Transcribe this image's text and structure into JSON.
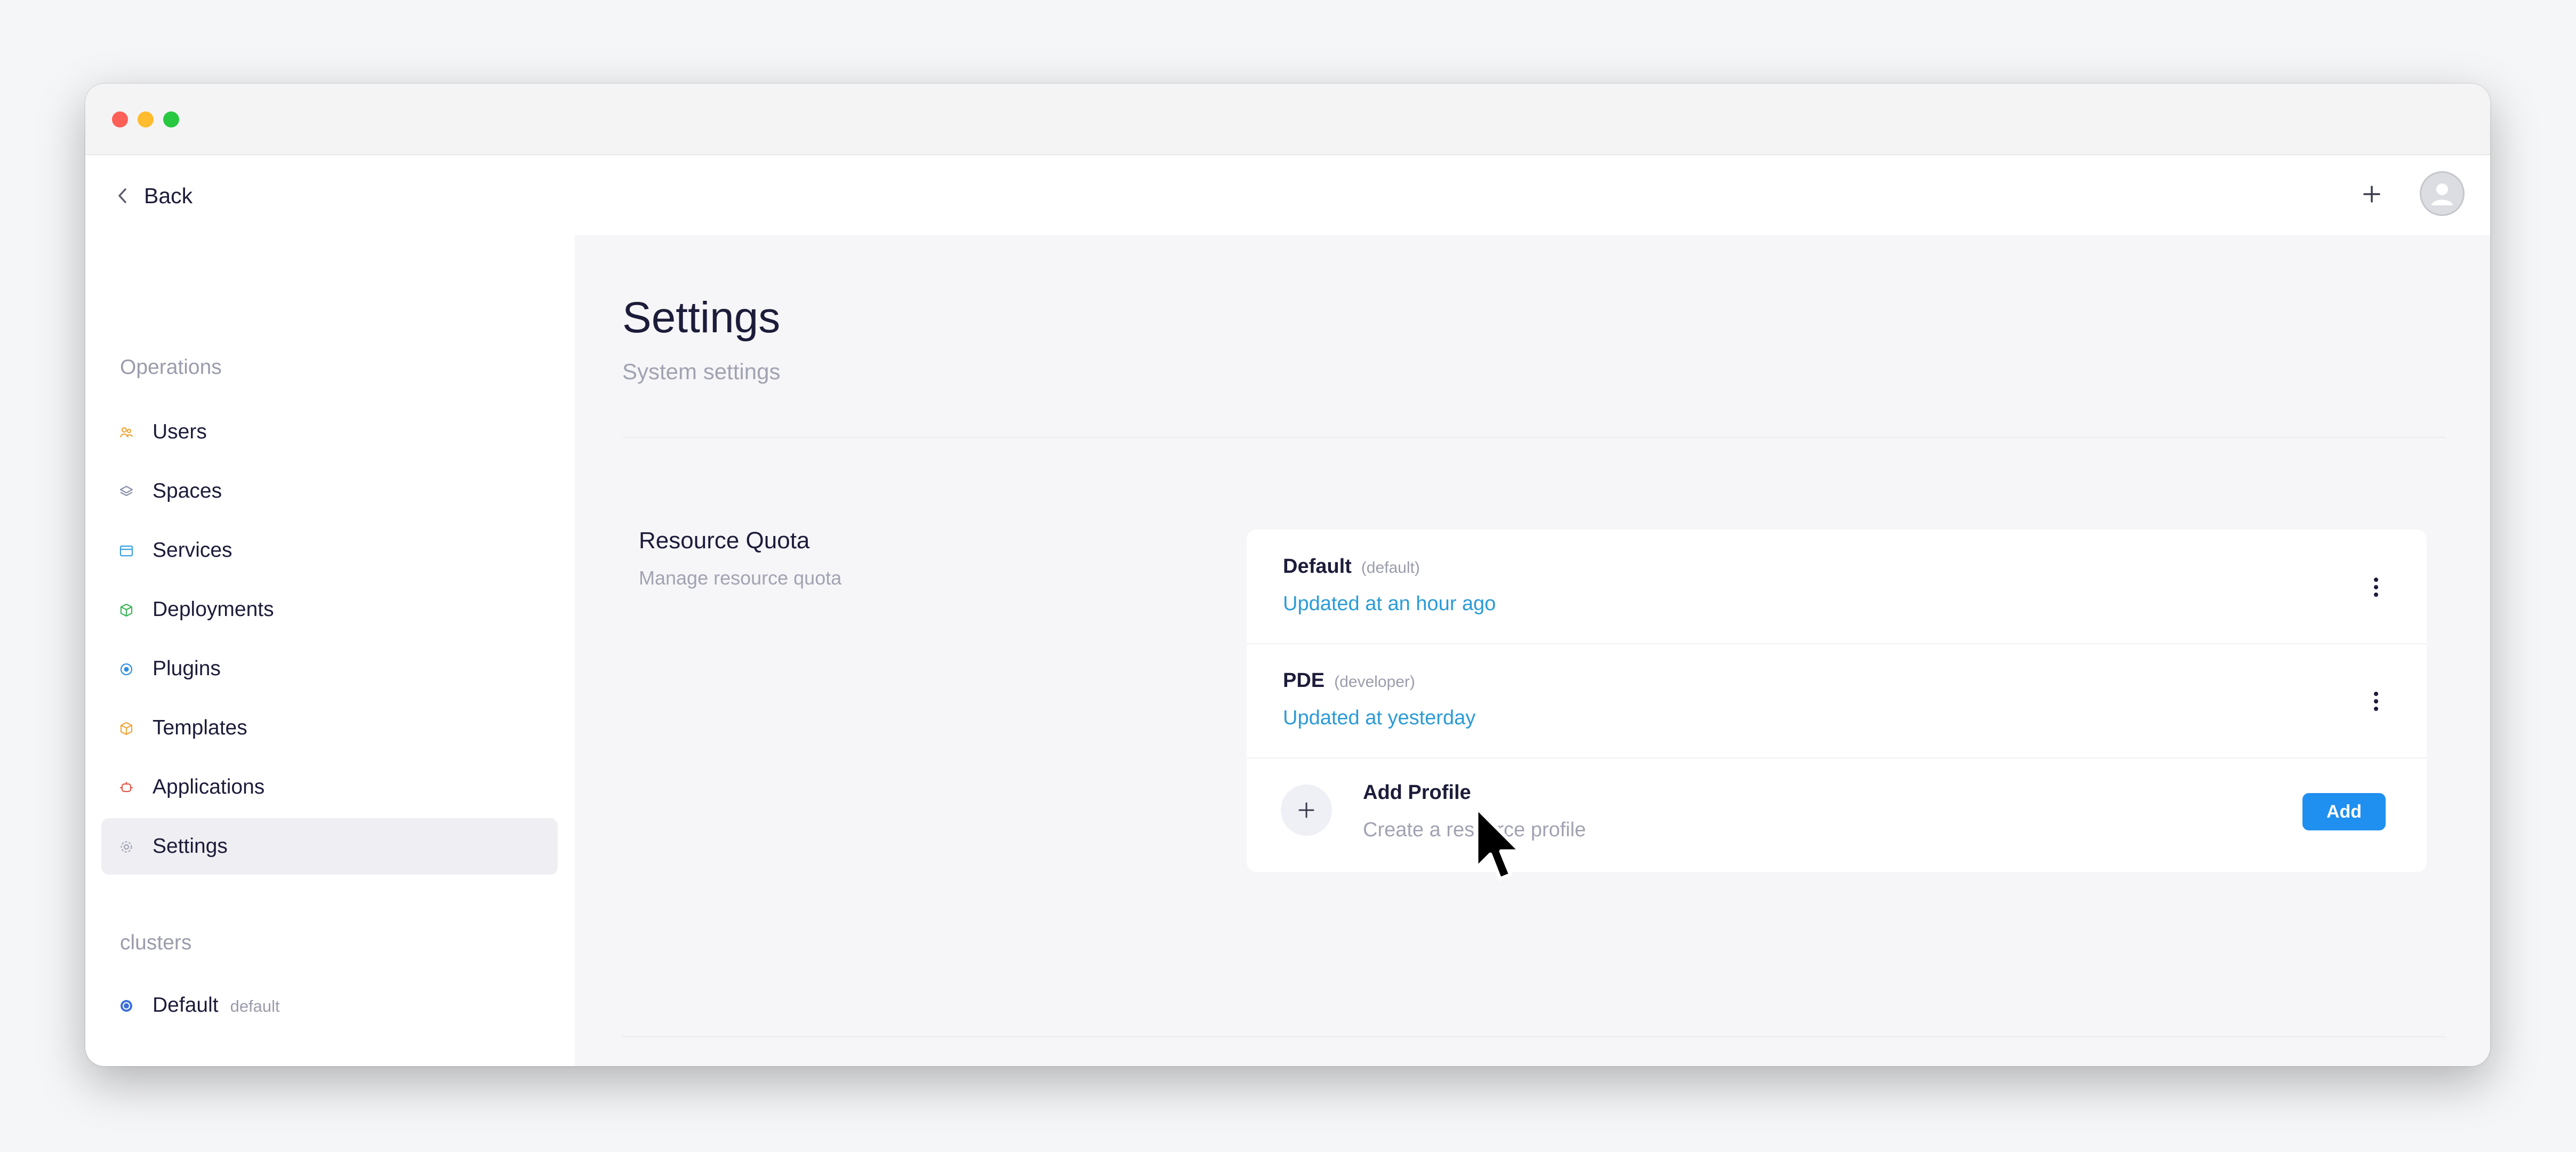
{
  "header": {
    "back_label": "Back"
  },
  "sidebar": {
    "section_operations": "Operations",
    "items": [
      {
        "label": "Users",
        "icon": "users-icon",
        "color": "#f0a63a"
      },
      {
        "label": "Spaces",
        "icon": "layers-icon",
        "color": "#8a8fa8"
      },
      {
        "label": "Services",
        "icon": "browser-window-icon",
        "color": "#3aa0e0"
      },
      {
        "label": "Deployments",
        "icon": "cube-icon",
        "color": "#3cb55a"
      },
      {
        "label": "Plugins",
        "icon": "plugin-icon",
        "color": "#2f8fe0"
      },
      {
        "label": "Templates",
        "icon": "box-icon",
        "color": "#f0a63a"
      },
      {
        "label": "Applications",
        "icon": "app-icon",
        "color": "#e05a4a"
      },
      {
        "label": "Settings",
        "icon": "gear-icon",
        "color": "#a0a3b4",
        "active": true
      }
    ],
    "section_clusters": "clusters",
    "clusters": [
      {
        "label": "Default",
        "tag": "default",
        "icon": "cluster-icon",
        "color": "#3b6fd8"
      }
    ]
  },
  "main": {
    "title": "Settings",
    "subtitle": "System settings",
    "section": {
      "title": "Resource Quota",
      "subtitle": "Manage resource quota"
    },
    "profiles": [
      {
        "name": "Default",
        "key": "(default)",
        "updated": "Updated at an hour ago"
      },
      {
        "name": "PDE",
        "key": "(developer)",
        "updated": "Updated at yesterday"
      }
    ],
    "add_profile": {
      "title": "Add Profile",
      "subtitle": "Create a resource profile",
      "button_label": "Add"
    }
  },
  "colors": {
    "accent": "#1f8ff0",
    "link": "#2b9bd8"
  }
}
